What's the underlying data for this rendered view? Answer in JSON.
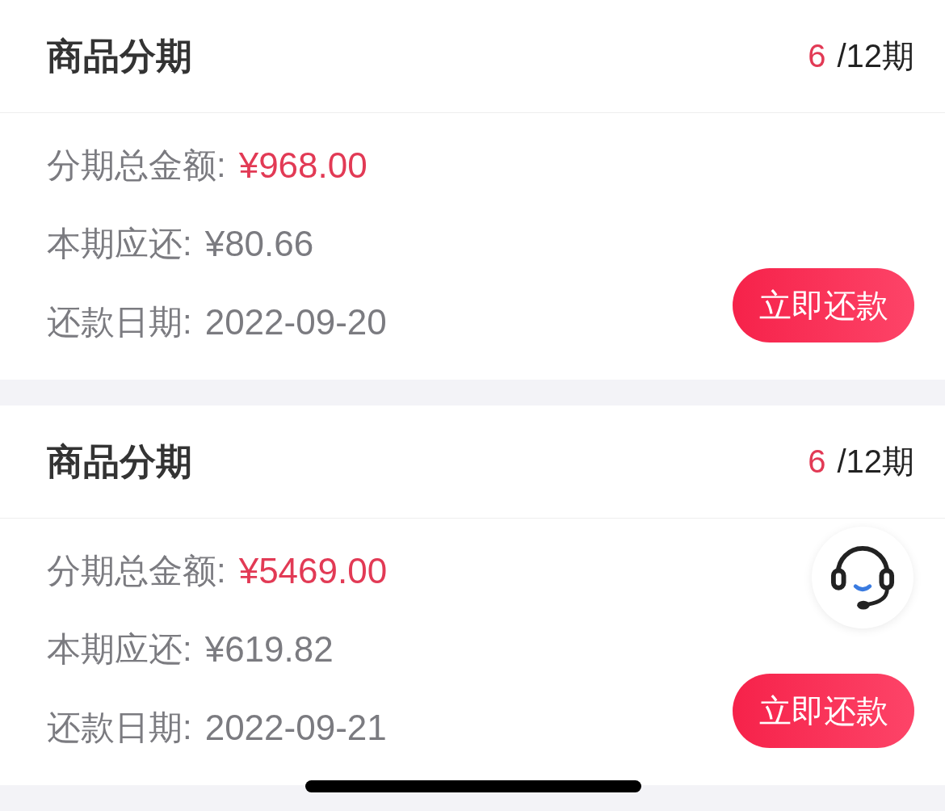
{
  "plans": [
    {
      "title": "商品分期",
      "period_current": "6",
      "period_total": "/12期",
      "fields": [
        {
          "label": "分期总金额:",
          "value": "¥968.00",
          "kind": "amount"
        },
        {
          "label": "本期应还:",
          "value": "¥80.66",
          "kind": "plain"
        },
        {
          "label": "还款日期:",
          "value": "2022-09-20",
          "kind": "plain"
        }
      ],
      "action": "立即还款"
    },
    {
      "title": "商品分期",
      "period_current": "6",
      "period_total": "/12期",
      "fields": [
        {
          "label": "分期总金额:",
          "value": "¥5469.00",
          "kind": "amount"
        },
        {
          "label": "本期应还:",
          "value": "¥619.82",
          "kind": "plain"
        },
        {
          "label": "还款日期:",
          "value": "2022-09-21",
          "kind": "plain"
        }
      ],
      "action": "立即还款"
    }
  ]
}
